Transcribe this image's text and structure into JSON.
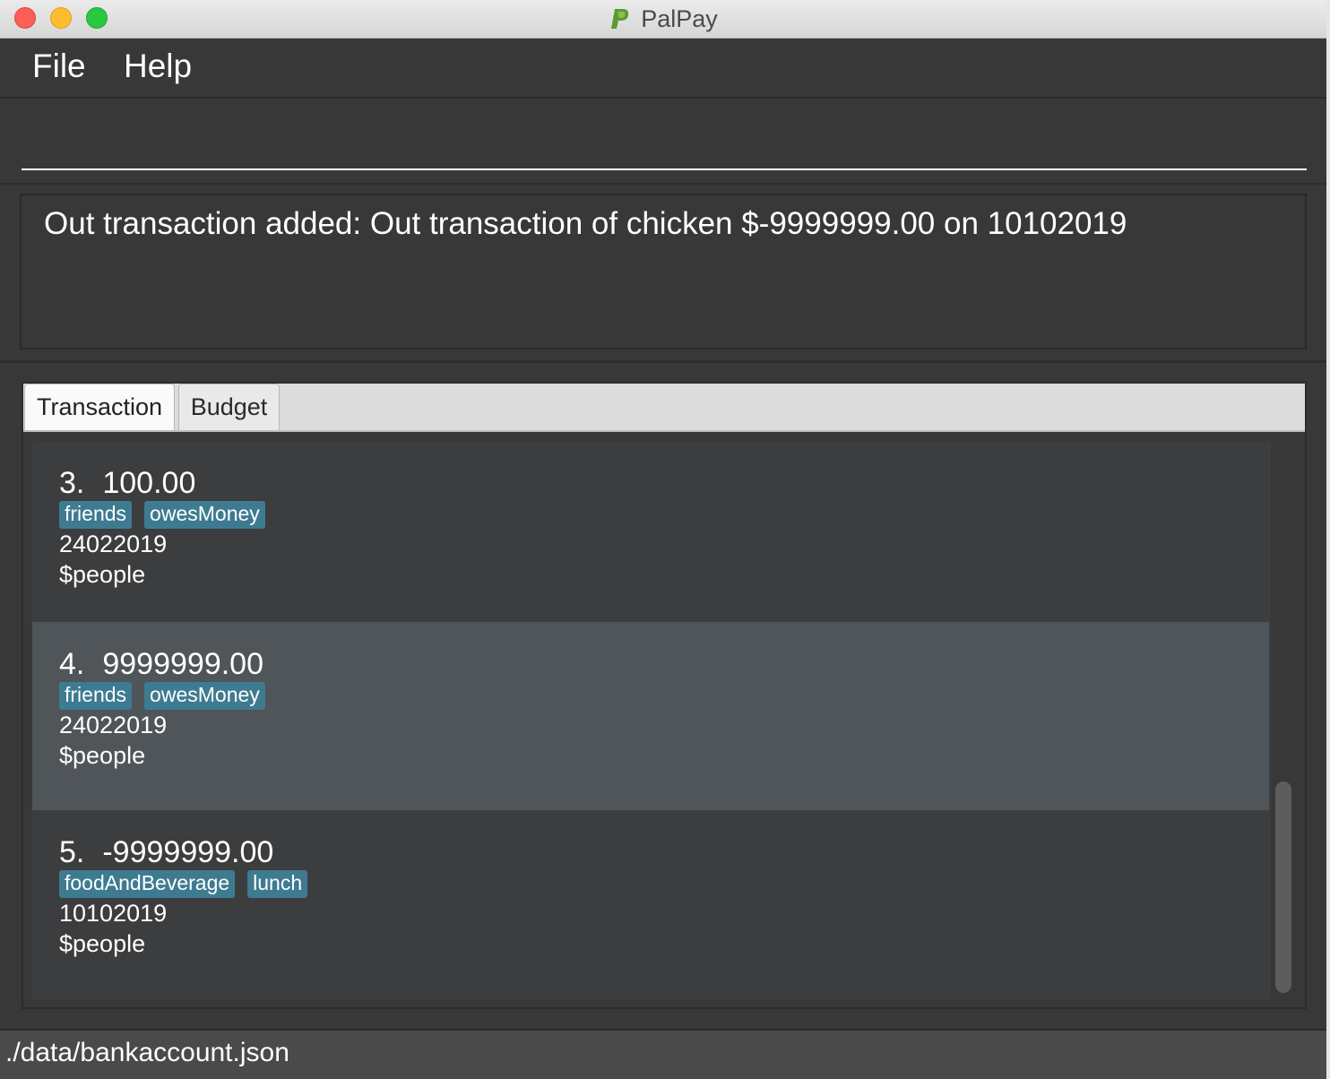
{
  "window": {
    "title": "PalPay"
  },
  "menu": {
    "items": [
      "File",
      "Help"
    ]
  },
  "command": {
    "value": ""
  },
  "result": {
    "message": "Out transaction added: Out transaction of chicken $-9999999.00 on 10102019"
  },
  "tabs": [
    {
      "label": "Transaction",
      "active": true
    },
    {
      "label": "Budget",
      "active": false
    }
  ],
  "transactions": [
    {
      "index": "3.",
      "amount": "100.00",
      "tags": [
        "friends",
        "owesMoney"
      ],
      "date": "24022019",
      "people": "$people",
      "selected": false
    },
    {
      "index": "4.",
      "amount": "9999999.00",
      "tags": [
        "friends",
        "owesMoney"
      ],
      "date": "24022019",
      "people": "$people",
      "selected": true
    },
    {
      "index": "5.",
      "amount": "-9999999.00",
      "tags": [
        "foodAndBeverage",
        "lunch"
      ],
      "date": "10102019",
      "people": "$people",
      "selected": false
    }
  ],
  "status": {
    "file_path": "./data/bankaccount.json"
  },
  "colors": {
    "background": "#383838",
    "tag": "#3e7b91",
    "selected_card": "#4f5559",
    "card": "#3c3d3f"
  }
}
